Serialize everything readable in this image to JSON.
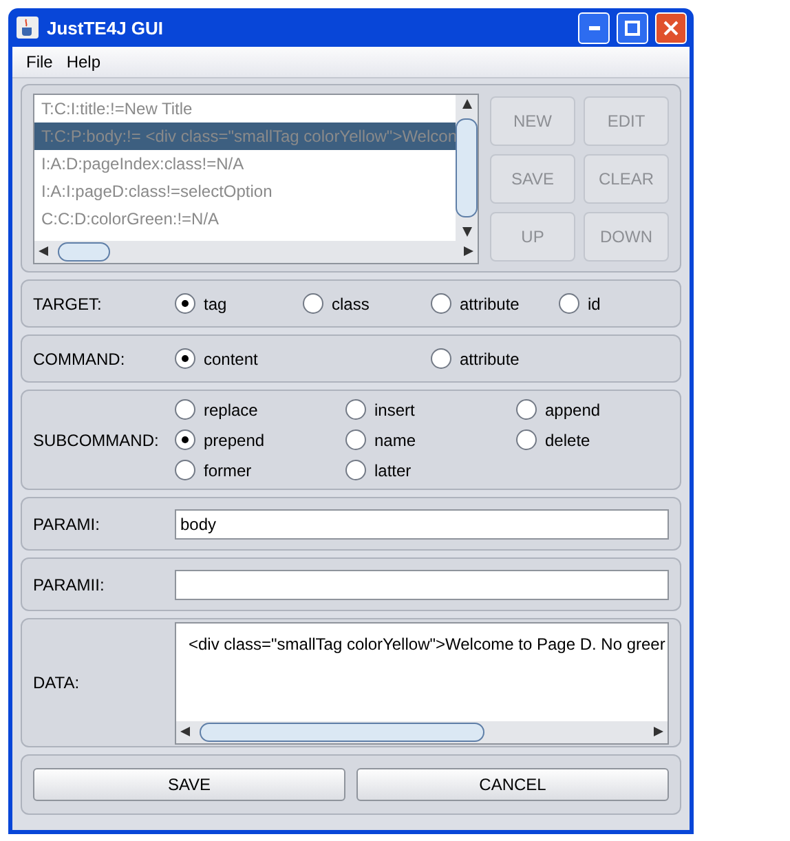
{
  "window": {
    "title": "JustTE4J GUI"
  },
  "menu": [
    "File",
    "Help"
  ],
  "entries": [
    {
      "text": "T:C:I:title:!=New Title",
      "selected": false
    },
    {
      "text": "T:C:P:body:!= <div class=\"smallTag colorYellow\">Welcon",
      "selected": true
    },
    {
      "text": "I:A:D:pageIndex:class!=N/A",
      "selected": false
    },
    {
      "text": "I:A:I:pageD:class!=selectOption",
      "selected": false
    },
    {
      "text": "C:C:D:colorGreen:!=N/A",
      "selected": false
    }
  ],
  "entry_buttons": [
    {
      "label": "NEW",
      "disabled": true
    },
    {
      "label": "EDIT",
      "disabled": true
    },
    {
      "label": "SAVE",
      "disabled": true
    },
    {
      "label": "CLEAR",
      "disabled": true
    },
    {
      "label": "UP",
      "disabled": true
    },
    {
      "label": "DOWN",
      "disabled": true
    }
  ],
  "groups": [
    {
      "label": "TARGET:",
      "kind": "row",
      "options": [
        {
          "label": "tag",
          "selected": true
        },
        {
          "label": "class",
          "selected": false
        },
        {
          "label": "attribute",
          "selected": false
        },
        {
          "label": "id",
          "selected": false
        }
      ]
    },
    {
      "label": "COMMAND:",
      "kind": "pair",
      "options": [
        {
          "label": "content",
          "selected": true
        },
        {
          "label": "attribute",
          "selected": false
        }
      ]
    },
    {
      "label": "SUBCOMMAND:",
      "kind": "grid",
      "options": [
        {
          "label": "replace",
          "selected": false
        },
        {
          "label": "insert",
          "selected": false
        },
        {
          "label": "append",
          "selected": false
        },
        {
          "label": "prepend",
          "selected": true
        },
        {
          "label": "name",
          "selected": false
        },
        {
          "label": "delete",
          "selected": false
        },
        {
          "label": "former",
          "selected": false
        },
        {
          "label": "latter",
          "selected": false
        }
      ]
    }
  ],
  "params": [
    {
      "label": "PARAMI:",
      "value": "body"
    },
    {
      "label": "PARAMII:"
    }
  ],
  "data": {
    "label": "DATA:",
    "value": "<div class=\"smallTag colorYellow\">Welcome to Page D. No greer"
  },
  "footer_buttons": [
    "SAVE",
    "CANCEL"
  ]
}
